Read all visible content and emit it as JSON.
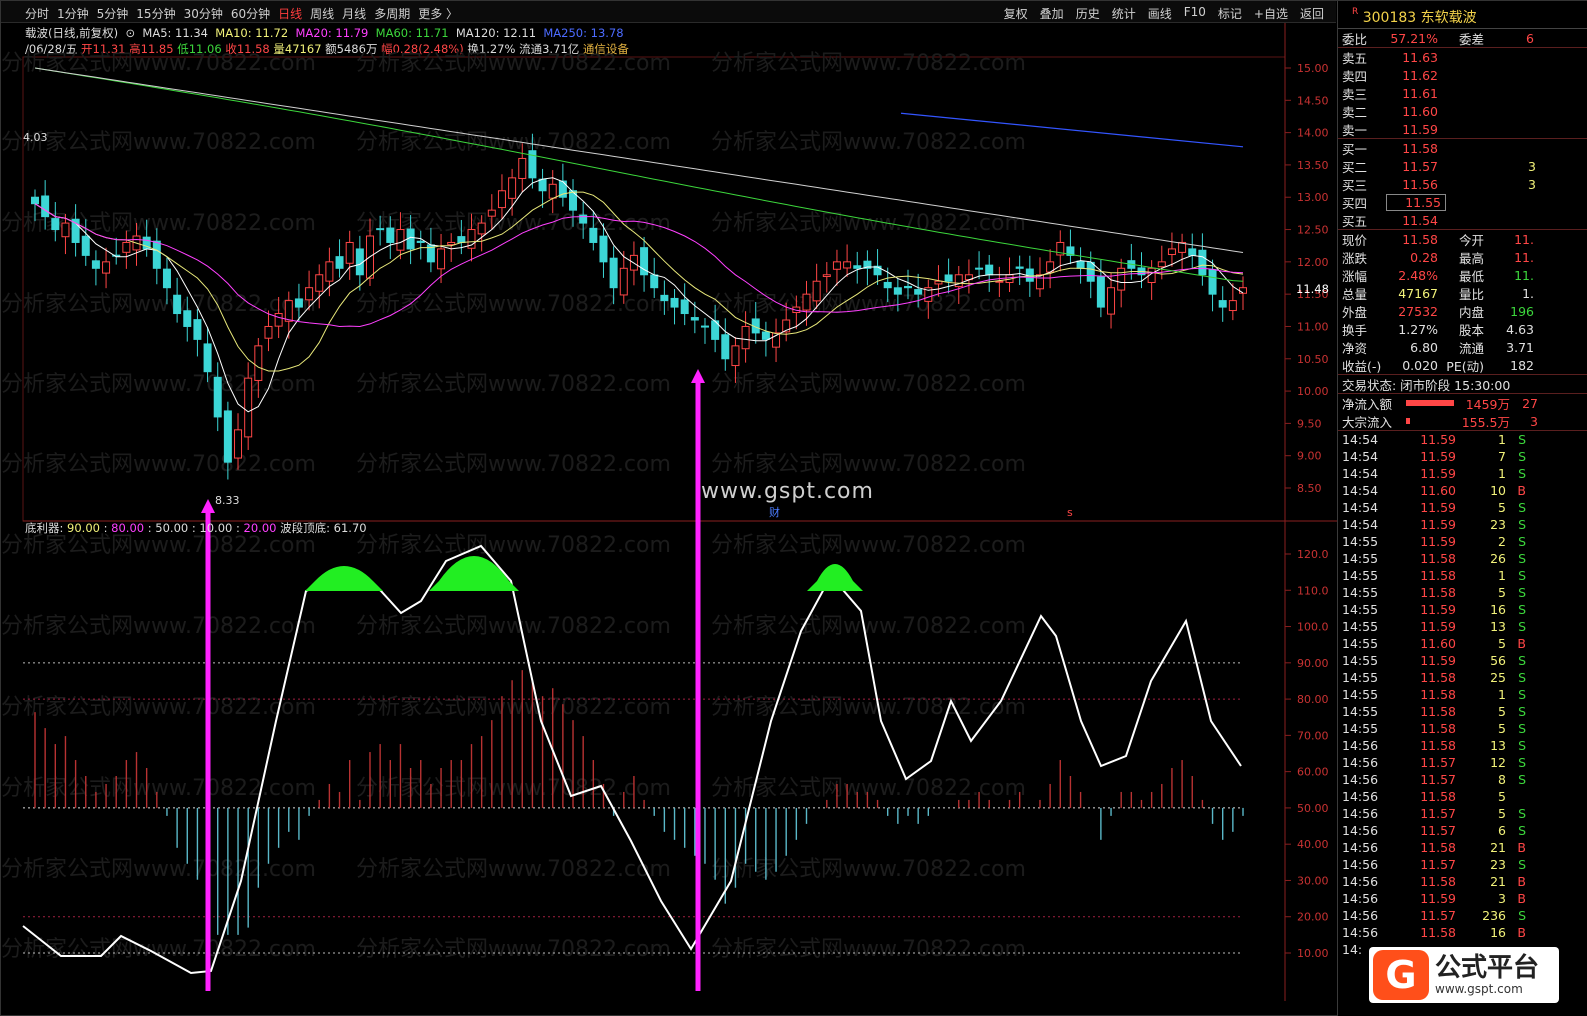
{
  "periods": [
    "分时",
    "1分钟",
    "5分钟",
    "15分钟",
    "30分钟",
    "60分钟",
    "日线",
    "周线",
    "月线",
    "多周期",
    "更多 〉"
  ],
  "active_period": "日线",
  "tools": [
    "复权",
    "叠加",
    "历史",
    "统计",
    "画线",
    "F10",
    "标记",
    "+自选",
    "返回"
  ],
  "stock_title": "300183 东软载波",
  "info1": {
    "name": "载波(日线,前复权)",
    "ma5": "MA5: 11.34",
    "ma10": "MA10: 11.72",
    "ma20": "MA20: 11.79",
    "ma60": "MA60: 11.71",
    "ma120": "MA120: 12.11",
    "ma250": "MA250: 13.78"
  },
  "info2": {
    "date": "/06/28/五",
    "open": "开11.31",
    "high": "高11.85",
    "low": "低11.06",
    "close": "收11.58",
    "vol": "量47167",
    "amt": "额5486万",
    "chg": "幅0.28(2.48%)",
    "turn": "换1.27%",
    "float": "流通3.71亿",
    "sector": "通信设备"
  },
  "price_axis": [
    "15.00",
    "14.50",
    "14.00",
    "13.50",
    "13.00",
    "12.50",
    "12.00",
    "11.50",
    "11.00",
    "10.50",
    "10.00",
    "9.50",
    "9.00",
    "8.50"
  ],
  "current_price_label": "11.48",
  "low_mark": "8.33",
  "left_mark": "4.03",
  "indicator_line": {
    "name": "底利器",
    "v1": "90.00",
    "v2": "80.00",
    "v3": "50.00",
    "v4": "10.00",
    "v5": "20.00",
    "wave": "波段顶底: 61.70"
  },
  "ind_axis": [
    "120.0",
    "110.0",
    "100.0",
    "90.00",
    "80.00",
    "70.00",
    "60.00",
    "50.00",
    "40.00",
    "30.00",
    "20.00",
    "10.00"
  ],
  "watermark_text": "分析家公式网www.70822.com",
  "site_text": "www.gspt.com",
  "fin_mark": "财",
  "s_mark": "s",
  "order_book": {
    "weibi_label": "委比",
    "weibi": "57.21%",
    "weicha_label": "委差",
    "weicha": "6",
    "asks": [
      {
        "label": "卖五",
        "price": "11.63",
        "vol": ""
      },
      {
        "label": "卖四",
        "price": "11.62",
        "vol": ""
      },
      {
        "label": "卖三",
        "price": "11.61",
        "vol": ""
      },
      {
        "label": "卖二",
        "price": "11.60",
        "vol": ""
      },
      {
        "label": "卖一",
        "price": "11.59",
        "vol": ""
      }
    ],
    "bids": [
      {
        "label": "买一",
        "price": "11.58",
        "vol": ""
      },
      {
        "label": "买二",
        "price": "11.57",
        "vol": "3"
      },
      {
        "label": "买三",
        "price": "11.56",
        "vol": "3"
      },
      {
        "label": "买四",
        "price": "11.55",
        "vol": ""
      },
      {
        "label": "买五",
        "price": "11.54",
        "vol": ""
      }
    ]
  },
  "quote": [
    {
      "l1": "现价",
      "v1": "11.58",
      "l2": "今开",
      "v2": "11."
    },
    {
      "l1": "涨跌",
      "v1": "0.28",
      "l2": "最高",
      "v2": "11."
    },
    {
      "l1": "涨幅",
      "v1": "2.48%",
      "l2": "最低",
      "v2": "11."
    },
    {
      "l1": "总量",
      "v1": "47167",
      "l2": "量比",
      "v2": "1."
    },
    {
      "l1": "外盘",
      "v1": "27532",
      "l2": "内盘",
      "v2": "196"
    },
    {
      "l1": "换手",
      "v1": "1.27%",
      "l2": "股本",
      "v2": "4.63"
    },
    {
      "l1": "净资",
      "v1": "6.80",
      "l2": "流通",
      "v2": "3.71"
    },
    {
      "l1": "收益(-)",
      "v1": "0.020",
      "l2": "PE(动)",
      "v2": "182"
    }
  ],
  "trade_status": "交易状态: 闭市阶段 15:30:00",
  "net_inflow_label": "净流入额",
  "net_inflow": "1459万",
  "net_inflow_extra": "27",
  "block_inflow_label": "大宗流入",
  "block_inflow": "155.5万",
  "block_inflow_extra": "3",
  "ticks": [
    {
      "t": "14:54",
      "p": "11.59",
      "v": "1",
      "s": "S"
    },
    {
      "t": "14:54",
      "p": "11.59",
      "v": "7",
      "s": "S"
    },
    {
      "t": "14:54",
      "p": "11.59",
      "v": "1",
      "s": "S"
    },
    {
      "t": "14:54",
      "p": "11.60",
      "v": "10",
      "s": "B"
    },
    {
      "t": "14:54",
      "p": "11.59",
      "v": "5",
      "s": "S"
    },
    {
      "t": "14:54",
      "p": "11.59",
      "v": "23",
      "s": "S"
    },
    {
      "t": "14:55",
      "p": "11.59",
      "v": "2",
      "s": "S"
    },
    {
      "t": "14:55",
      "p": "11.58",
      "v": "26",
      "s": "S"
    },
    {
      "t": "14:55",
      "p": "11.58",
      "v": "1",
      "s": "S"
    },
    {
      "t": "14:55",
      "p": "11.58",
      "v": "5",
      "s": "S"
    },
    {
      "t": "14:55",
      "p": "11.59",
      "v": "16",
      "s": "S"
    },
    {
      "t": "14:55",
      "p": "11.59",
      "v": "13",
      "s": "S"
    },
    {
      "t": "14:55",
      "p": "11.60",
      "v": "5",
      "s": "B"
    },
    {
      "t": "14:55",
      "p": "11.59",
      "v": "56",
      "s": "S"
    },
    {
      "t": "14:55",
      "p": "11.58",
      "v": "25",
      "s": "S"
    },
    {
      "t": "14:55",
      "p": "11.58",
      "v": "1",
      "s": "S"
    },
    {
      "t": "14:55",
      "p": "11.58",
      "v": "5",
      "s": "S"
    },
    {
      "t": "14:55",
      "p": "11.58",
      "v": "5",
      "s": "S"
    },
    {
      "t": "14:56",
      "p": "11.58",
      "v": "13",
      "s": "S"
    },
    {
      "t": "14:56",
      "p": "11.57",
      "v": "12",
      "s": "S"
    },
    {
      "t": "14:56",
      "p": "11.57",
      "v": "8",
      "s": "S"
    },
    {
      "t": "14:56",
      "p": "11.58",
      "v": "5",
      "s": ""
    },
    {
      "t": "14:56",
      "p": "11.57",
      "v": "5",
      "s": "S"
    },
    {
      "t": "14:56",
      "p": "11.57",
      "v": "6",
      "s": "S"
    },
    {
      "t": "14:56",
      "p": "11.58",
      "v": "21",
      "s": "B"
    },
    {
      "t": "14:56",
      "p": "11.57",
      "v": "23",
      "s": "S"
    },
    {
      "t": "14:56",
      "p": "11.58",
      "v": "21",
      "s": "B"
    },
    {
      "t": "14:56",
      "p": "11.59",
      "v": "3",
      "s": "B"
    },
    {
      "t": "14:56",
      "p": "11.57",
      "v": "236",
      "s": "S"
    },
    {
      "t": "14:56",
      "p": "11.58",
      "v": "16",
      "s": "B"
    },
    {
      "t": "14:",
      "p": "",
      "v": "",
      "s": ""
    }
  ],
  "logo": {
    "glyph": "G",
    "line1": "公式平台",
    "line2": "www.gspt.com"
  },
  "colors": {
    "up": "#ff4646",
    "down": "#3cd6d6",
    "ma5": "#ffffff",
    "ma10": "#e8e87a",
    "ma20": "#ff40ff",
    "ma60": "#3cd63c",
    "ma120": "#d0d0d0",
    "ma250": "#3355ff"
  }
}
